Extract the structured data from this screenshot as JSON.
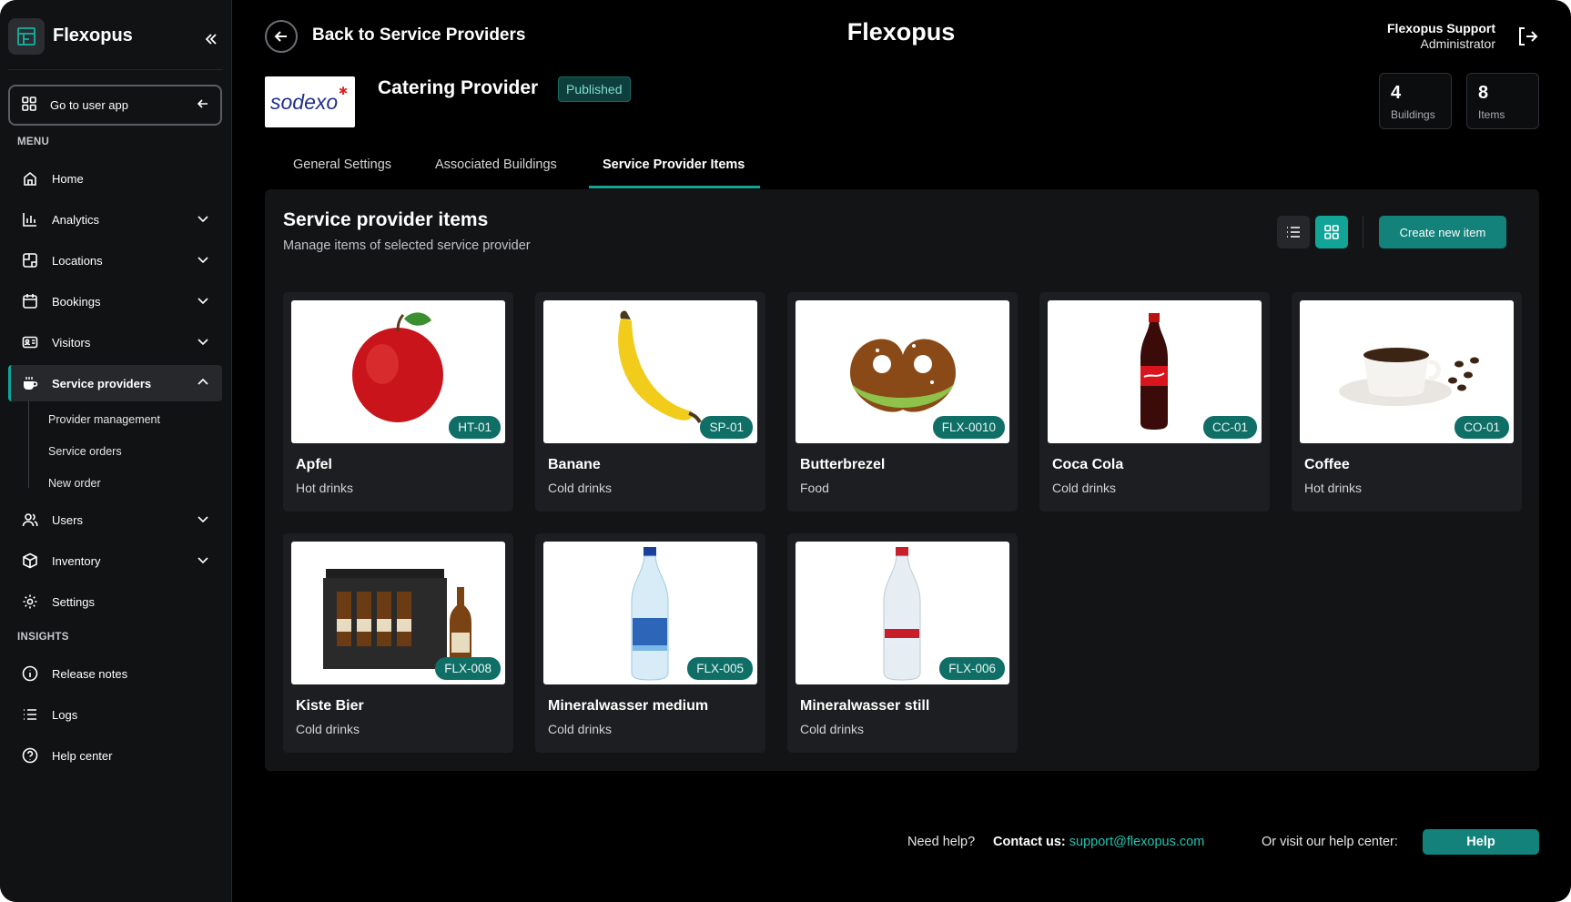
{
  "sidebar": {
    "brand": "Flexopus",
    "user_app": "Go to user app",
    "menu_label": "MENU",
    "insights_label": "INSIGHTS",
    "items": {
      "home": "Home",
      "analytics": "Analytics",
      "locations": "Locations",
      "bookings": "Bookings",
      "visitors": "Visitors",
      "service_providers": "Service providers",
      "users": "Users",
      "inventory": "Inventory",
      "settings": "Settings",
      "release_notes": "Release notes",
      "logs": "Logs",
      "help_center": "Help center"
    },
    "sub_items": {
      "provider_management": "Provider management",
      "service_orders": "Service orders",
      "new_order": "New order"
    }
  },
  "header": {
    "back_label": "Back to Service Providers",
    "title": "Flexopus",
    "user_name": "Flexopus Support",
    "user_role": "Administrator"
  },
  "provider": {
    "logo_text": "sodexo",
    "name": "Catering Provider",
    "status": "Published",
    "stats": [
      {
        "value": "4",
        "label": "Buildings"
      },
      {
        "value": "8",
        "label": "Items"
      }
    ]
  },
  "tabs": [
    "General Settings",
    "Associated Buildings",
    "Service Provider Items"
  ],
  "panel": {
    "title": "Service provider items",
    "subtitle": "Manage items of selected service provider",
    "create_label": "Create new item"
  },
  "items": [
    {
      "name": "Apfel",
      "category": "Hot drinks",
      "code": "HT-01",
      "icon": "apple-image"
    },
    {
      "name": "Banane",
      "category": "Cold drinks",
      "code": "SP-01",
      "icon": "banana-image"
    },
    {
      "name": "Butterbrezel",
      "category": "Food",
      "code": "FLX-0010",
      "icon": "pretzel-image"
    },
    {
      "name": "Coca Cola",
      "category": "Cold drinks",
      "code": "CC-01",
      "icon": "cola-bottle-image"
    },
    {
      "name": "Coffee",
      "category": "Hot drinks",
      "code": "CO-01",
      "icon": "coffee-cup-image"
    },
    {
      "name": "Kiste Bier",
      "category": "Cold drinks",
      "code": "FLX-008",
      "icon": "beer-crate-image"
    },
    {
      "name": "Mineralwasser medium",
      "category": "Cold drinks",
      "code": "FLX-005",
      "icon": "water-bottle-image"
    },
    {
      "name": "Mineralwasser still",
      "category": "Cold drinks",
      "code": "FLX-006",
      "icon": "water-bottle-image"
    }
  ],
  "footer": {
    "need_help": "Need help?",
    "contact_label": "Contact us:",
    "email": "support@flexopus.com",
    "visit": "Or visit our help center:",
    "help_button": "Help"
  },
  "colors": {
    "accent": "#12a597",
    "button": "#12827a",
    "background": "#000000"
  }
}
